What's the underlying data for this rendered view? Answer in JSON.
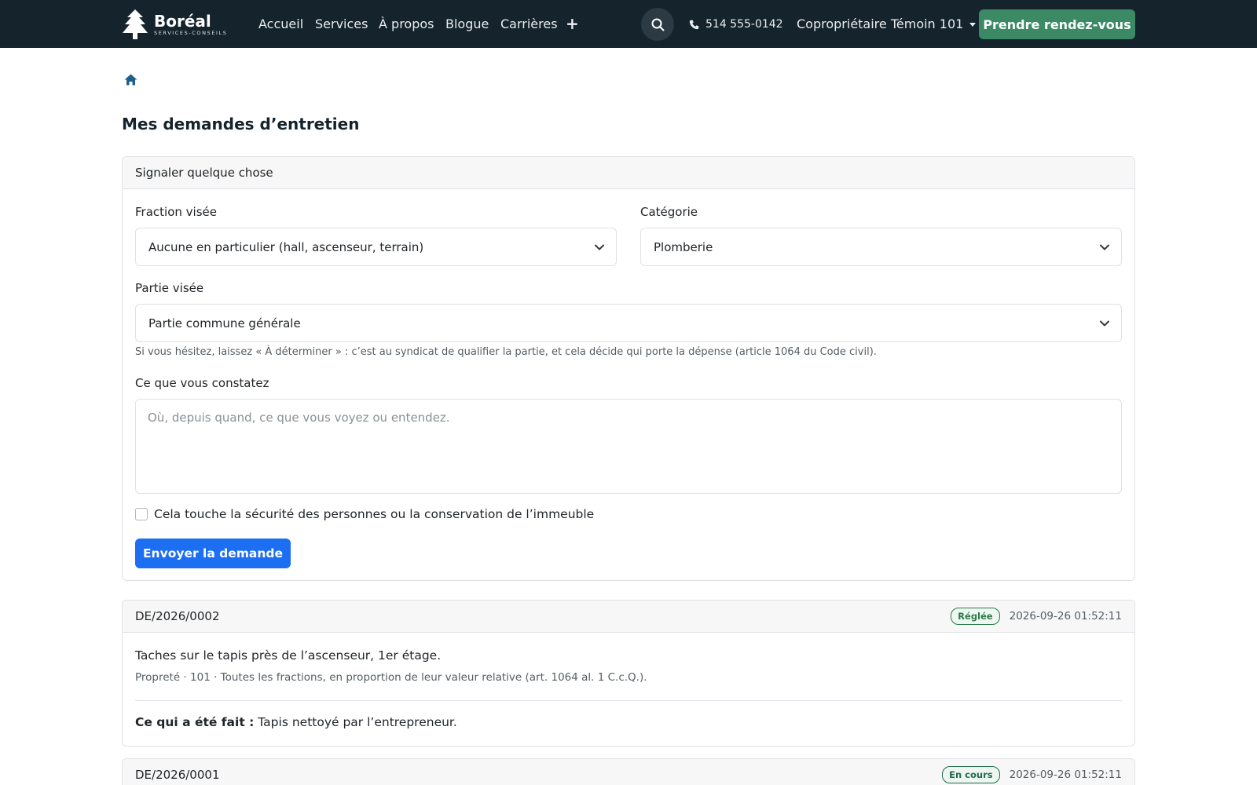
{
  "brand": {
    "name": "Boréal",
    "subtitle": "SERVICES-CONSEILS"
  },
  "nav": {
    "items": [
      "Accueil",
      "Services",
      "À propos",
      "Blogue",
      "Carrières"
    ],
    "more": "+"
  },
  "header": {
    "phone": "514 555-0142",
    "user": "Copropriétaire Témoin 101",
    "cta": "Prendre rendez-vous"
  },
  "page": {
    "title": "Mes demandes d’entretien"
  },
  "form": {
    "title": "Signaler quelque chose",
    "fraction_label": "Fraction visée",
    "fraction_value": "Aucune en particulier (hall, ascenseur, terrain)",
    "category_label": "Catégorie",
    "category_value": "Plomberie",
    "part_label": "Partie visée",
    "part_value": "Partie commune générale",
    "help": "Si vous hésitez, laissez « À déterminer » : c’est au syndicat de qualifier la partie, et cela décide qui porte la dépense (article 1064 du Code civil).",
    "observation_label": "Ce que vous constatez",
    "observation_placeholder": "Où, depuis quand, ce que vous voyez ou entendez.",
    "safety_label": "Cela touche la sécurité des personnes ou la conservation de l’immeuble",
    "submit_label": "Envoyer la demande"
  },
  "requests": [
    {
      "id": "DE/2026/0002",
      "status": "Réglée",
      "date": "2026-09-26 01:52:11",
      "description": "Taches sur le tapis près de l’ascenseur, 1er étage.",
      "meta": "Propreté · 101 · Toutes les fractions, en proportion de leur valeur relative (art. 1064 al. 1 C.c.Q.).",
      "done_label": "Ce qui a été fait :",
      "done_text": "Tapis nettoyé par l’entrepreneur."
    },
    {
      "id": "DE/2026/0001",
      "status": "En cours",
      "date": "2026-09-26 01:52:11"
    }
  ],
  "colors": {
    "navbar": "#15232c",
    "cta": "#3b8a65",
    "primary": "#1c6ff2",
    "badge_resolved": "#2b7a4b",
    "badge_in_progress": "#1f6b4a"
  }
}
